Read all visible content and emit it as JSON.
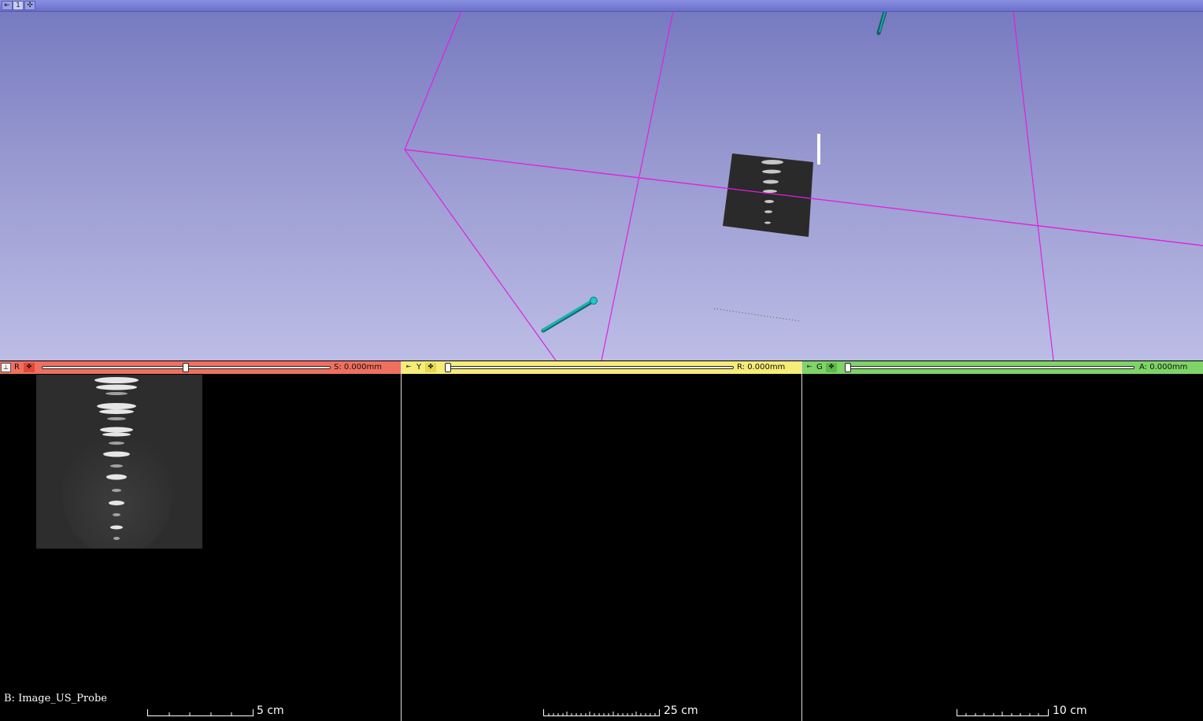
{
  "view3d": {
    "view_number": "1",
    "pin_icon": "pin-icon",
    "center_icon": "center-view-icon",
    "colors": {
      "box": "#e020e0",
      "tool": "#1aa6a8",
      "bg_top": "#7478bf",
      "bg_bottom": "#bcbde6"
    }
  },
  "slices": {
    "red": {
      "label": "R",
      "offset": "S: 0.000mm",
      "color": "#f07060",
      "slider_fraction": 0.5
    },
    "yellow": {
      "label": "Y",
      "offset": "R: 0.000mm",
      "color": "#f6ec78",
      "slider_fraction": 0.0
    },
    "green": {
      "label": "G",
      "offset": "A: 0.000mm",
      "color": "#7fd468",
      "slider_fraction": 0.0
    }
  },
  "red_view": {
    "volume_label": "B: Image_US_Probe",
    "ruler_label": "5 cm"
  },
  "yellow_view": {
    "ruler_label": "25 cm"
  },
  "green_view": {
    "ruler_label": "10 cm"
  }
}
